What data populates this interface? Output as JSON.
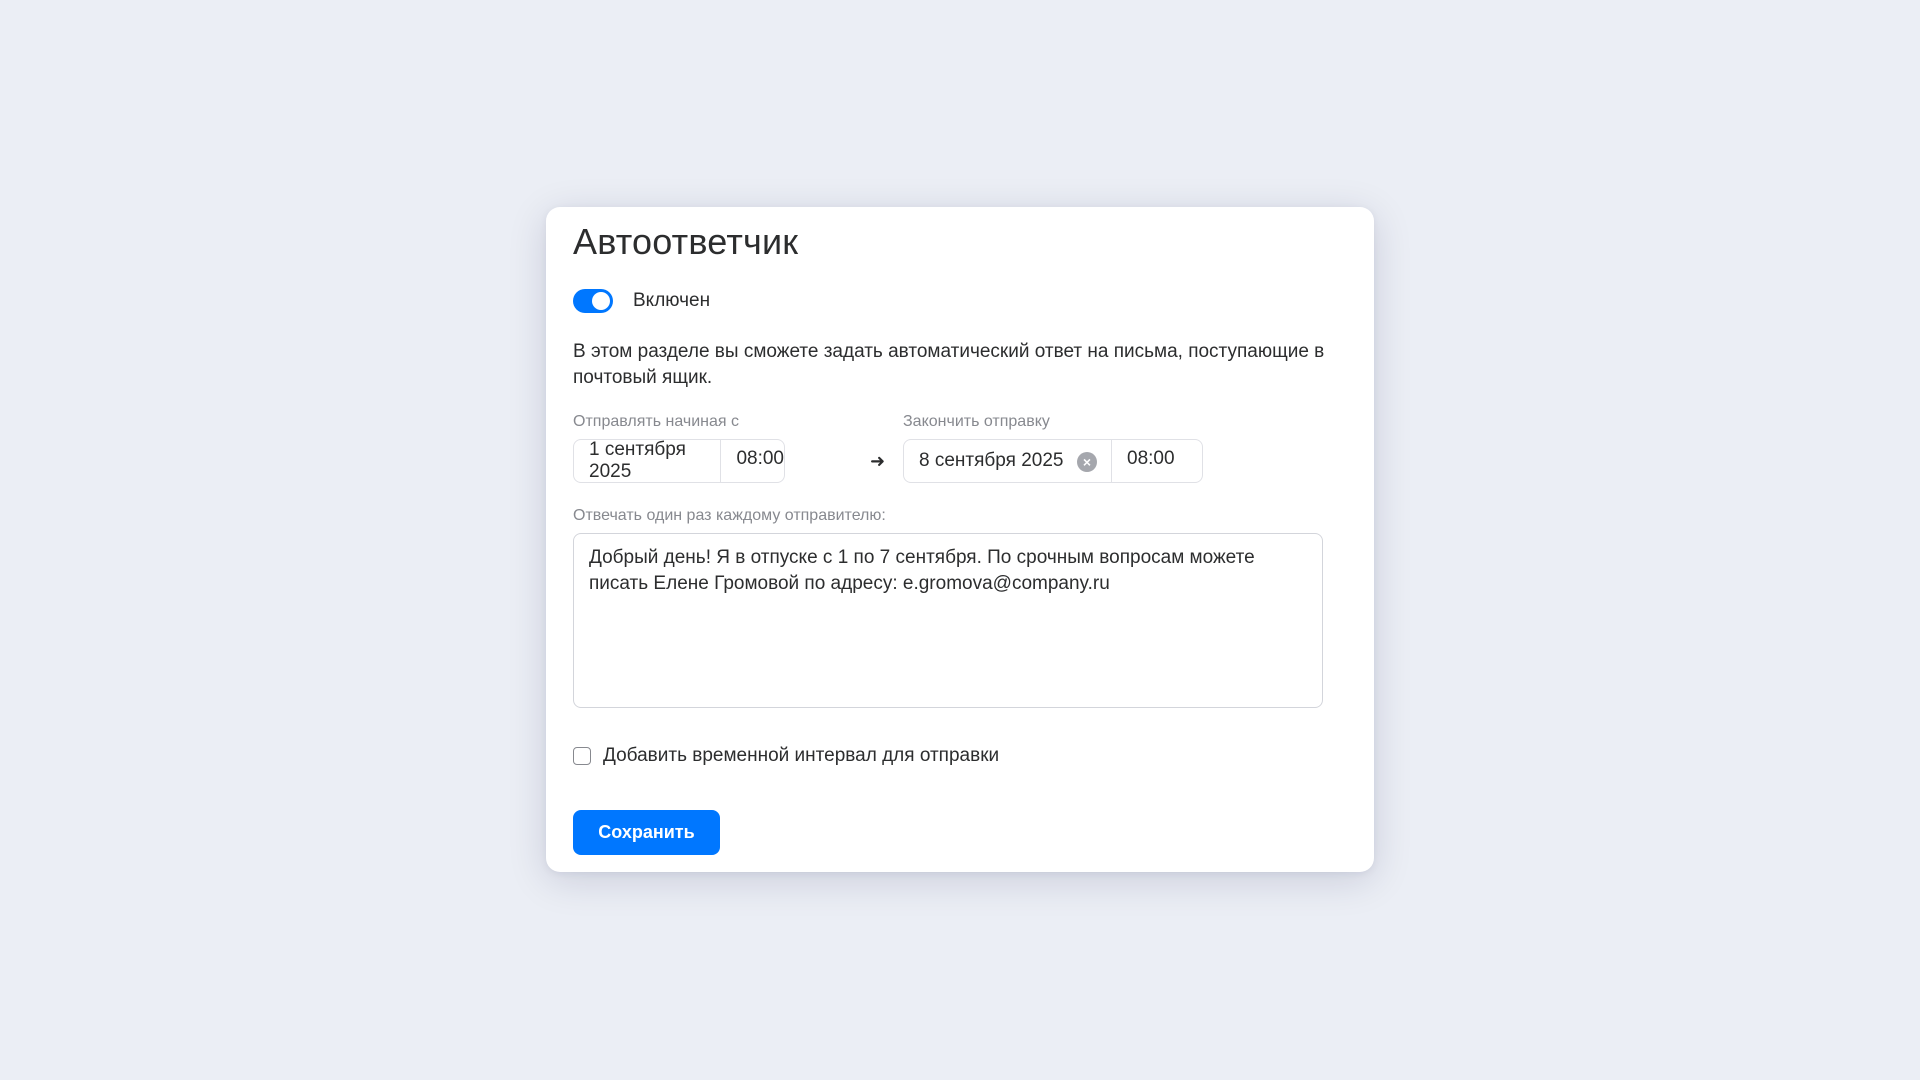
{
  "dialog": {
    "title": "Автоответчик",
    "toggle": {
      "label": "Включен",
      "enabled": true,
      "color": "#0077ff"
    },
    "description": "В этом разделе вы сможете задать автоматический ответ на письма, поступающие в почтовый ящик.",
    "start": {
      "label": "Отправлять начиная с",
      "date": "1 сентября 2025",
      "time": "08:00"
    },
    "end": {
      "label": "Закончить отправку",
      "date": "8 сентября 2025",
      "time": "08:00"
    },
    "reply": {
      "label": "Отвечать один раз каждому отправителю:",
      "text": "Добрый день! Я в отпуске с 1 по 7 сентября. По срочным вопросам можете писать Елене Громовой по адресу: e.gromova@company.ru"
    },
    "interval_checkbox": {
      "label": "Добавить временной интервал для отправки",
      "checked": false
    },
    "save_label": "Сохранить",
    "icons": {
      "arrow": "arrow-right-icon",
      "clear": "clear-icon"
    },
    "colors": {
      "accent": "#0077ff",
      "background": "#ebeef5"
    }
  }
}
